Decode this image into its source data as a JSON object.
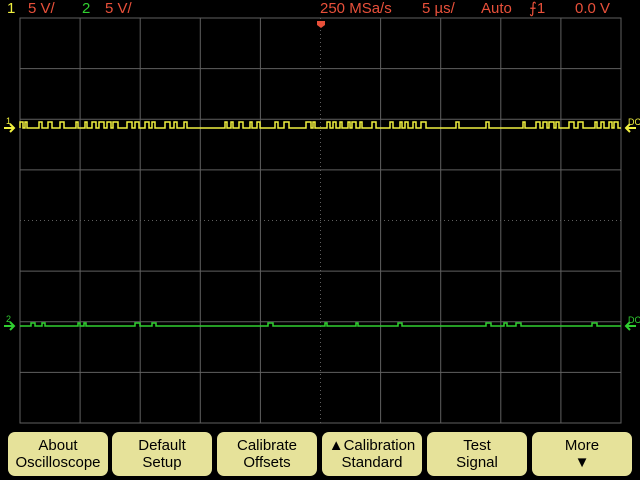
{
  "header": {
    "ch1_label": "1",
    "ch1_scale": "5 V/",
    "ch2_label": "2",
    "ch2_scale": "5 V/",
    "sample_rate": "250 MSa/s",
    "timebase": "5 µs/",
    "trigger_mode": "Auto",
    "trigger_source": "⨍1",
    "trigger_level": "0.0 V"
  },
  "channels": [
    {
      "id": "1",
      "color": "#f0f040",
      "coupling": "DC"
    },
    {
      "id": "2",
      "color": "#30d030",
      "coupling": "DC"
    }
  ],
  "softkeys": [
    {
      "line1": "About",
      "line2": "Oscilloscope"
    },
    {
      "line1": "Default",
      "line2": "Setup"
    },
    {
      "line1": "Calibrate",
      "line2": "Offsets"
    },
    {
      "line1": "▲Calibration",
      "line2": "Standard"
    },
    {
      "line1": "Test",
      "line2": "Signal"
    },
    {
      "line1": "More",
      "line2": "▼"
    }
  ],
  "colors": {
    "grid": "#606060",
    "softkey": "#e6e29a",
    "header_red": "#e8503a"
  }
}
